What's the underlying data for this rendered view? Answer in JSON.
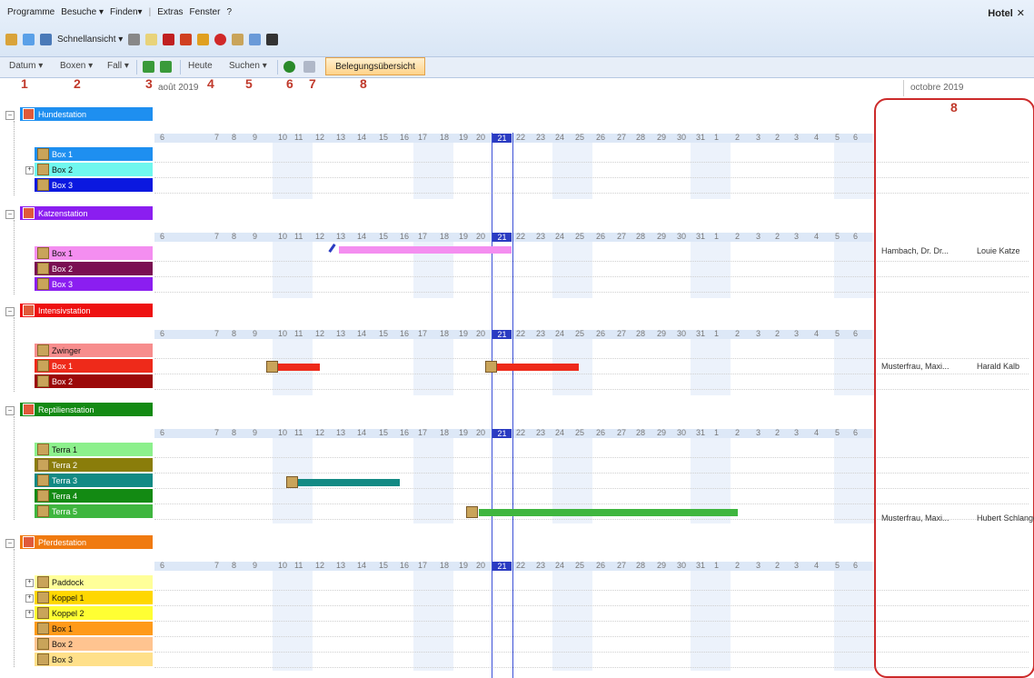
{
  "menu": {
    "items": [
      "Programme",
      "Besuche ▾",
      "Finden▾",
      "Extras",
      "Fenster",
      "?"
    ],
    "right_title": "Hotel",
    "close_glyph": "✕"
  },
  "toolbar1": {
    "schnell_label": "Schnellansicht ▾"
  },
  "toolbar2": {
    "datum": "Datum ▾",
    "boxen": "Boxen ▾",
    "fall": "Fall ▾",
    "heute": "Heute",
    "suchen": "Suchen ▾",
    "belegung": "Belegungsübersicht"
  },
  "annotations": [
    "1",
    "2",
    "3",
    "4",
    "5",
    "6",
    "7",
    "8"
  ],
  "side_annotation": "8",
  "months": {
    "left": "août 2019",
    "right": "octobre 2019"
  },
  "days": [
    "6",
    "7",
    "8",
    "9",
    "10",
    "11",
    "12",
    "13",
    "14",
    "15",
    "16",
    "17",
    "18",
    "19",
    "20",
    "21",
    "22",
    "23",
    "24",
    "25",
    "26",
    "27",
    "28",
    "29",
    "30",
    "31",
    "1",
    "2",
    "3",
    "2",
    "3",
    "4",
    "5",
    "6"
  ],
  "today_label": "21",
  "stations": [
    {
      "name": "Hundestation",
      "color": "#1e8ff0",
      "boxes": [
        {
          "label": "Box 1",
          "color": "#1e8ff0",
          "text": "#fff"
        },
        {
          "label": "Box 2",
          "color": "#6ff7ee",
          "text": "#111",
          "expandable": true
        },
        {
          "label": "Box 3",
          "color": "#0b18e0",
          "text": "#fff"
        }
      ]
    },
    {
      "name": "Katzenstation",
      "color": "#8b1ef0",
      "boxes": [
        {
          "label": "Box 1",
          "color": "#f48ef0",
          "text": "#111"
        },
        {
          "label": "Box 2",
          "color": "#7a0f52",
          "text": "#fff"
        },
        {
          "label": "Box 3",
          "color": "#8b1ef0",
          "text": "#fff"
        }
      ]
    },
    {
      "name": "Intensivstation",
      "color": "#ee1111",
      "boxes": [
        {
          "label": "Zwinger",
          "color": "#f78d8d",
          "text": "#111"
        },
        {
          "label": "Box 1",
          "color": "#ee2a1a",
          "text": "#fff"
        },
        {
          "label": "Box 2",
          "color": "#9c0909",
          "text": "#fff"
        }
      ]
    },
    {
      "name": "Reptilienstation",
      "color": "#138a13",
      "boxes": [
        {
          "label": "Terra 1",
          "color": "#8cf08c",
          "text": "#111"
        },
        {
          "label": "Terra 2",
          "color": "#8a7d0a",
          "text": "#fff"
        },
        {
          "label": "Terra 3",
          "color": "#138a84",
          "text": "#fff"
        },
        {
          "label": "Terra 4",
          "color": "#138a13",
          "text": "#fff"
        },
        {
          "label": "Terra 5",
          "color": "#3fb63f",
          "text": "#fff"
        }
      ]
    },
    {
      "name": "Pferdestation",
      "color": "#f07a10",
      "boxes": [
        {
          "label": "Paddock",
          "color": "#ffff99",
          "text": "#111",
          "expandable": true
        },
        {
          "label": "Koppel 1",
          "color": "#ffd700",
          "text": "#111",
          "expandable": true
        },
        {
          "label": "Koppel 2",
          "color": "#ffff33",
          "text": "#111",
          "expandable": true
        },
        {
          "label": "Box 1",
          "color": "#ff9a1a",
          "text": "#111"
        },
        {
          "label": "Box 2",
          "color": "#ffc490",
          "text": "#111"
        },
        {
          "label": "Box 3",
          "color": "#ffe08a",
          "text": "#111"
        }
      ]
    }
  ],
  "side_entries": [
    {
      "owner": "Hambach, Dr. Dr...",
      "patient": "Louie Katze"
    },
    {
      "owner": "Musterfrau, Maxi...",
      "patient": "Harald Kalb"
    },
    {
      "owner": "Musterfrau, Maxi...",
      "patient": "Hubert Schlange"
    }
  ]
}
